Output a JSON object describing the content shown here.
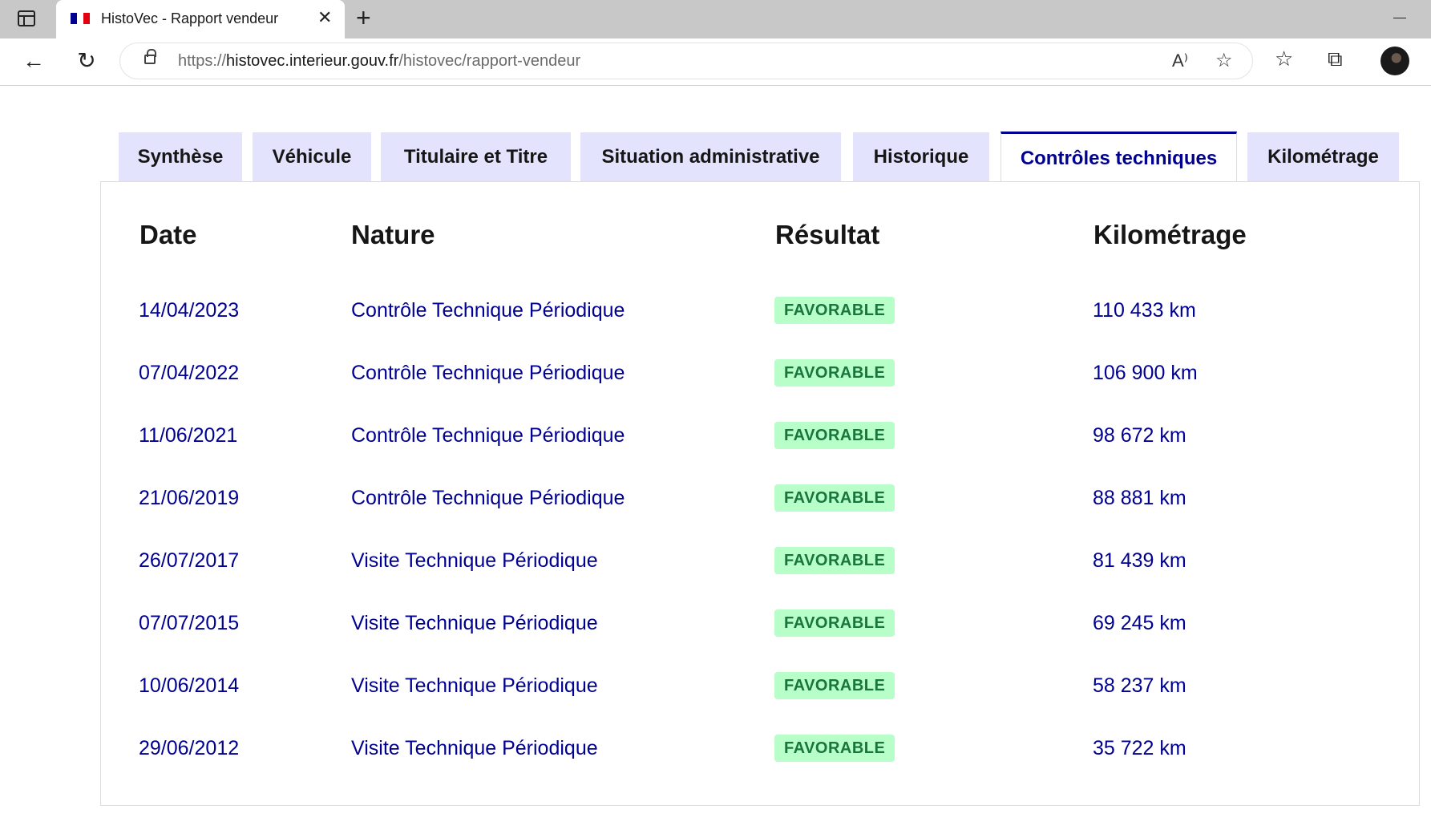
{
  "browser": {
    "tab_title": "HistoVec - Rapport vendeur",
    "url_scheme": "https://",
    "url_host": "histovec.interieur.gouv.fr",
    "url_path": "/histovec/rapport-vendeur",
    "close_glyph": "✕",
    "new_tab_glyph": "+",
    "back_glyph": "←",
    "reload_glyph": "↻",
    "read_aloud_glyph": "A⁾",
    "favorite_add_glyph": "☆",
    "favorites_glyph": "☆",
    "collections_glyph": "⧉"
  },
  "tabs": [
    {
      "label": "Synthèse",
      "active": false
    },
    {
      "label": "Véhicule",
      "active": false
    },
    {
      "label": "Titulaire et Titre",
      "active": false
    },
    {
      "label": "Situation administrative",
      "active": false
    },
    {
      "label": "Historique",
      "active": false
    },
    {
      "label": "Contrôles techniques",
      "active": true
    },
    {
      "label": "Kilométrage",
      "active": false
    }
  ],
  "table": {
    "headers": {
      "date": "Date",
      "nature": "Nature",
      "result": "Résultat",
      "mileage": "Kilométrage"
    },
    "rows": [
      {
        "date": "14/04/2023",
        "nature": "Contrôle Technique Périodique",
        "result": "FAVORABLE",
        "mileage": "110 433 km"
      },
      {
        "date": "07/04/2022",
        "nature": "Contrôle Technique Périodique",
        "result": "FAVORABLE",
        "mileage": "106 900 km"
      },
      {
        "date": "11/06/2021",
        "nature": "Contrôle Technique Périodique",
        "result": "FAVORABLE",
        "mileage": "98 672 km"
      },
      {
        "date": "21/06/2019",
        "nature": "Contrôle Technique Périodique",
        "result": "FAVORABLE",
        "mileage": "88 881 km"
      },
      {
        "date": "26/07/2017",
        "nature": "Visite Technique Périodique",
        "result": "FAVORABLE",
        "mileage": "81 439 km"
      },
      {
        "date": "07/07/2015",
        "nature": "Visite Technique Périodique",
        "result": "FAVORABLE",
        "mileage": "69 245 km"
      },
      {
        "date": "10/06/2014",
        "nature": "Visite Technique Périodique",
        "result": "FAVORABLE",
        "mileage": "58 237 km"
      },
      {
        "date": "29/06/2012",
        "nature": "Visite Technique Périodique",
        "result": "FAVORABLE",
        "mileage": "35 722 km"
      }
    ]
  },
  "colors": {
    "primary_blue": "#000091",
    "tab_bg": "#e3e3fd",
    "badge_bg": "#b8fec9",
    "badge_text": "#18753c"
  }
}
